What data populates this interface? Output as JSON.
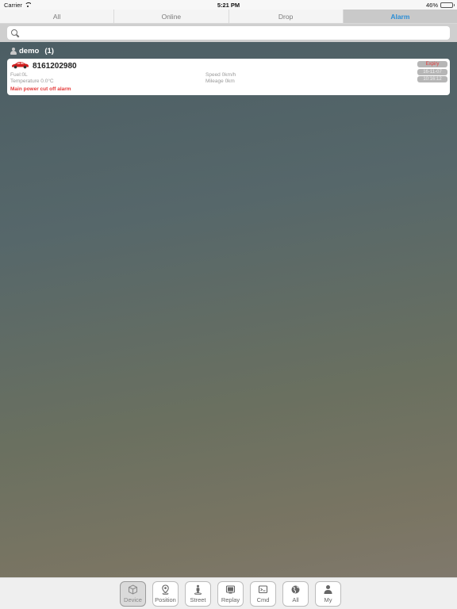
{
  "status_bar": {
    "carrier": "Carrier",
    "time": "5:21 PM",
    "battery": "46%",
    "battery_level": 0.46
  },
  "segments": [
    {
      "label": "All",
      "active": false
    },
    {
      "label": "Online",
      "active": false
    },
    {
      "label": "Drop",
      "active": false
    },
    {
      "label": "Alarm",
      "active": true
    }
  ],
  "search": {
    "placeholder": ""
  },
  "group": {
    "name": "demo",
    "count": "(1)"
  },
  "device": {
    "name": "8161202980",
    "fuel": "Fuel:0L",
    "temperature": "Temperature 0.0°C",
    "speed": "Speed 0km/h",
    "mileage": "Mileage 0km",
    "alarm": "Main power cut off alarm",
    "expiry": "Expiry",
    "date": "16-11-07",
    "time": "10:16:12"
  },
  "tabs": [
    {
      "label": "Device",
      "icon": "cube-icon",
      "active": true
    },
    {
      "label": "Position",
      "icon": "location-pin-icon",
      "active": false
    },
    {
      "label": "Street",
      "icon": "street-view-icon",
      "active": false
    },
    {
      "label": "Replay",
      "icon": "replay-icon",
      "active": false
    },
    {
      "label": "Cmd",
      "icon": "command-icon",
      "active": false
    },
    {
      "label": "All",
      "icon": "globe-icon",
      "active": false
    },
    {
      "label": "My",
      "icon": "person-icon",
      "active": false
    }
  ],
  "colors": {
    "accent": "#2b8ed6",
    "alarm": "#e53b3b",
    "car": "#d22020"
  }
}
